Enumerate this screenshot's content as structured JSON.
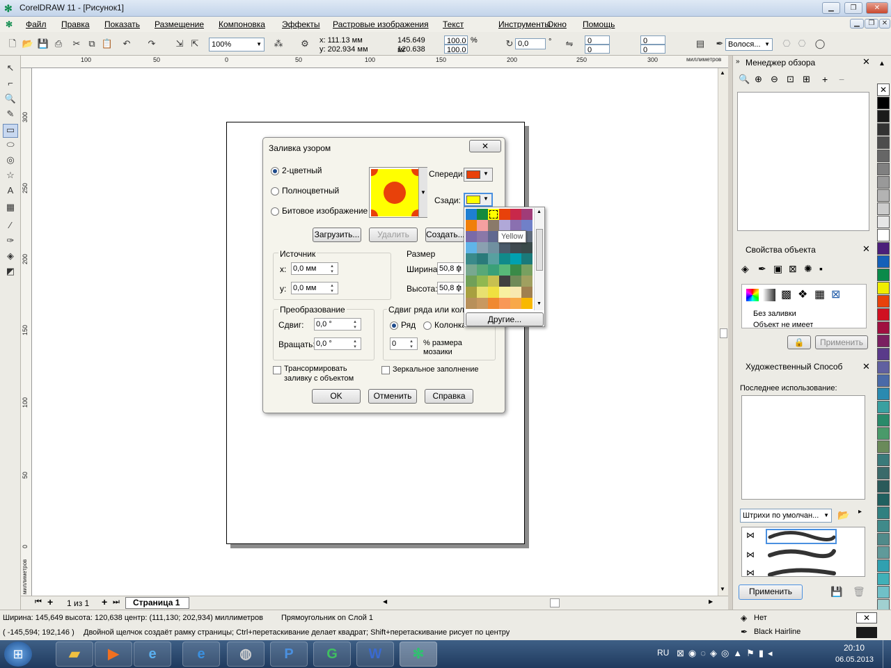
{
  "window": {
    "title": "CorelDRAW 11 - [Рисунок1]"
  },
  "menu": [
    "Файл",
    "Правка",
    "Показать",
    "Размещение",
    "Компоновка",
    "Эффекты",
    "Растровые изображения",
    "Текст",
    "Инструменты",
    "Окно",
    "Помощь"
  ],
  "toolbar": {
    "zoom": "100%",
    "x": "x: 111.13 мм",
    "y": "y: 202.934 мм",
    "w": "145.649 мг",
    "h": "120.638 мг",
    "sx": "100.0",
    "sy": "100.0",
    "pct": "%",
    "angle": "0,0",
    "deg": "°",
    "r1": "0",
    "r2": "0",
    "r3": "0",
    "r4": "0",
    "outline": "Волося..."
  },
  "ruler": {
    "h": [
      "100",
      "50",
      "0",
      "50",
      "100",
      "150",
      "200",
      "250",
      "300",
      "миллиметров"
    ],
    "v": [
      "300",
      "250",
      "200",
      "150",
      "100",
      "50",
      "0",
      "миллиметров"
    ]
  },
  "pages": {
    "count": "1 из 1",
    "tab": "Страница 1"
  },
  "dialog": {
    "title": "Заливка узором",
    "close": "✕",
    "mode_2color": "2-цветный",
    "mode_full": "Полноцветный",
    "mode_bitmap": "Битовое изображение",
    "front_label": "Спереди:",
    "back_label": "Сзади:",
    "load": "Загрузить...",
    "delete": "Удалить",
    "create": "Создать...",
    "source_title": "Источник",
    "x_label": "x:",
    "x_val": "0,0 мм",
    "y_label": "y:",
    "y_val": "0,0 мм",
    "size_title": "Размер",
    "width_label": "Ширина:",
    "width_val": "50,8 м",
    "height_label": "Высота:",
    "height_val": "50,8 м",
    "transform_title": "Преобразование",
    "skew_label": "Сдвиг:",
    "skew_val": "0,0 °",
    "rotate_label": "Вращать:",
    "rotate_val": "0,0 °",
    "offset_title": "Сдвиг ряда или колон",
    "row": "Ряд",
    "column": "Колонка",
    "offset_val": "0",
    "offset_text1": "% размера",
    "offset_text2": "мозаики",
    "transform_fill1": "Трансормировать",
    "transform_fill2": "заливку с объектом",
    "mirror": "Зеркальное заполнение",
    "ok": "OK",
    "cancel": "Отменить",
    "help": "Справка",
    "front_color": "#e8410a",
    "back_color": "#ffff00"
  },
  "color_popup": {
    "tooltip": "Yellow",
    "other": "Другие...",
    "colors": [
      [
        "#1e7fd2",
        "#138a3e",
        "#ffff00",
        "#e8410a",
        "#c8284a",
        "#a03c78"
      ],
      [
        "#f07f0a",
        "#f4a0a0",
        "#8a7a6a",
        "#b0a8d8",
        "#8a70b0",
        "#7080c8"
      ],
      [
        "#7a6aa8",
        "#8a78a8",
        "#606890",
        "#a0b8d8",
        "#90a0c0",
        "#606c7c"
      ],
      [
        "#60b4e8",
        "#8aa0b0",
        "#7090a0",
        "#4a5a6a",
        "#404a50",
        "#3a4a4a"
      ],
      [
        "#3a8a8a",
        "#2a7a7a",
        "#58a0a0",
        "#108a8a",
        "#00a0b0",
        "#1a7a7a"
      ],
      [
        "#78a890",
        "#58a878",
        "#3aa078",
        "#58b878",
        "#3a8a48",
        "#78a060"
      ],
      [
        "#70a058",
        "#90b850",
        "#c8c050",
        "#404040",
        "#708a58",
        "#a0a060"
      ],
      [
        "#a8a040",
        "#e8e070",
        "#f0e040",
        "#f8f0a0",
        "#f8e8b0",
        "#a08050"
      ],
      [
        "#b8905a",
        "#c89860",
        "#f08830",
        "#f89858",
        "#f8a848",
        "#f8b800"
      ]
    ]
  },
  "docker": {
    "viewmgr": "Менеджер обзора",
    "objprops": "Свойства объекта",
    "nofill": "Без заливки",
    "objnone": "Объект не имеет",
    "apply": "Применить",
    "artstroke": "Художественный Способ",
    "lastused": "Последнее использование:",
    "brushes": "Штрихи по умолчан...",
    "apply2": "Применить"
  },
  "status": {
    "line1": "Ширина: 145,649  высота: 120,638  центр: (111,130; 202,934)  миллиметров",
    "object": "Прямоугольник on Слой 1",
    "coords": "( -145,594; 192,146 )",
    "hint": "Двойной щелчок создаёт рамку страницы; Ctrl+перетаскивание делает квадрат; Shift+перетаскивание рисует по центру",
    "fill": "Нет",
    "outline": "Black  Hairline"
  },
  "taskbar": {
    "lang": "RU",
    "time": "20:10",
    "date": "06.05.2013"
  },
  "palette": [
    "#ffffff",
    "#000000",
    "#1a1a1a",
    "#333333",
    "#4d4d4d",
    "#666666",
    "#808080",
    "#999999",
    "#b3b3b3",
    "#cccccc",
    "#e6e6e6",
    "#ffffff",
    "#4b1f7a",
    "#1560b8",
    "#0a8a4a",
    "#f0ee00",
    "#e8410a",
    "#d01020",
    "#a01040",
    "#7a2060",
    "#5a3a8a",
    "#6060a0",
    "#4a6aa8",
    "#2a8ab0",
    "#3aa0a0",
    "#2a8a6a",
    "#4a9a6a",
    "#6a8a5a",
    "#3a7a7a",
    "#3a6a6a",
    "#2a5a5a",
    "#206060",
    "#308080",
    "#408a8a",
    "#508a8a",
    "#609a9a",
    "#30a0b0",
    "#40b0b8",
    "#70c0c8",
    "#a0d0d0"
  ]
}
